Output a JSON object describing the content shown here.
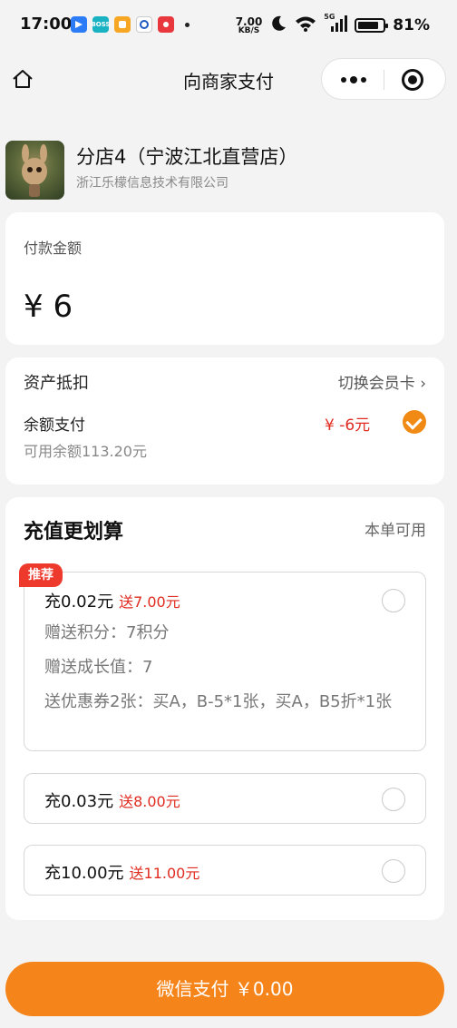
{
  "status_bar": {
    "time": "17:00",
    "apps": [
      {
        "icon": "flow-app-icon",
        "color": "#2b7cf6",
        "label": ""
      },
      {
        "icon": "boss-app-icon",
        "color": "#19b2c2",
        "label": "BOSS"
      },
      {
        "icon": "yellow-app-icon",
        "color": "#f6a623",
        "label": ""
      },
      {
        "icon": "bank-app-icon",
        "color": "#1f59c4",
        "label": ""
      },
      {
        "icon": "red-app-icon",
        "color": "#e8383d",
        "label": ""
      }
    ],
    "speed_value": "7.00",
    "speed_unit": "KB/S",
    "network": "5G",
    "battery_percent": "81%",
    "battery_level": 0.81
  },
  "nav": {
    "title": "向商家支付"
  },
  "merchant": {
    "store_name": "分店4（宁波江北直营店）",
    "company": "浙江乐檬信息技术有限公司"
  },
  "amount": {
    "label": "付款金额",
    "value": "¥ 6"
  },
  "assets": {
    "title": "资产抵扣",
    "switch_label": "切换会员卡 ›",
    "balance_label": "余额支付",
    "balance_deduct": "¥ -6元",
    "balance_checked": true,
    "available": "可用余额113.20元"
  },
  "recharge": {
    "title": "充值更划算",
    "availability": "本单可用",
    "options": [
      {
        "badge": "推荐",
        "main": "充0.02元",
        "gift": "送7.00元",
        "details": [
          "赠送积分：7积分",
          "赠送成长值：7",
          "送优惠券2张：买A，B-5*1张，买A，B5折*1张"
        ],
        "selected": false
      },
      {
        "main": "充0.03元",
        "gift": "送8.00元",
        "selected": false
      },
      {
        "main": "充10.00元",
        "gift": "送11.00元",
        "selected": false
      }
    ]
  },
  "pay_button": {
    "label": "微信支付 ￥0.00"
  },
  "colors": {
    "accent": "#f5841a",
    "price_red": "#e02c21",
    "badge_red": "#ee3a2d",
    "background": "#f3f3f3"
  }
}
